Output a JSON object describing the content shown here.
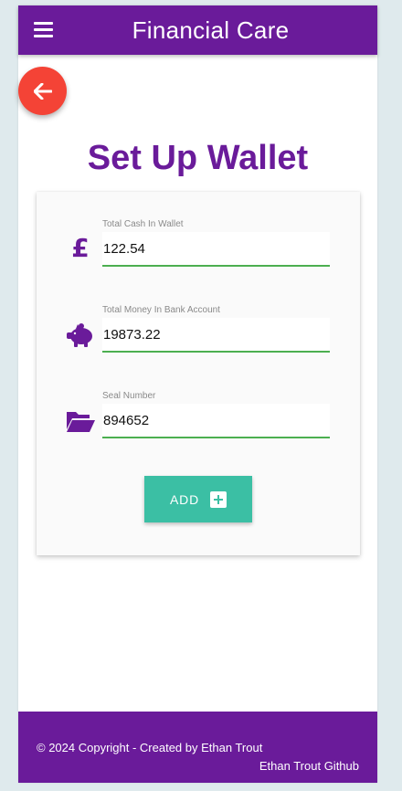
{
  "header": {
    "title": "Financial Care",
    "menu_icon": "hamburger-menu-icon"
  },
  "back_button": {
    "icon": "arrow-left-icon",
    "color": "#f44336"
  },
  "page": {
    "title": "Set Up Wallet"
  },
  "form": {
    "fields": [
      {
        "label": "Total Cash In Wallet",
        "value": "122.54",
        "icon": "pound-sign-icon"
      },
      {
        "label": "Total Money In Bank Account",
        "value": "19873.22",
        "icon": "piggy-bank-icon"
      },
      {
        "label": "Seal Number",
        "value": "894652",
        "icon": "folder-open-icon"
      }
    ],
    "submit_label": "ADD",
    "submit_icon": "plus-square-icon"
  },
  "footer": {
    "copyright": "© 2024 Copyright - Created by Ethan Trout",
    "github_link": "Ethan Trout Github"
  },
  "colors": {
    "primary": "#6a1b9a",
    "accent": "#3bbfa4",
    "input_underline": "#4caf50",
    "back_button": "#f44336",
    "page_background": "#dfeaed"
  }
}
